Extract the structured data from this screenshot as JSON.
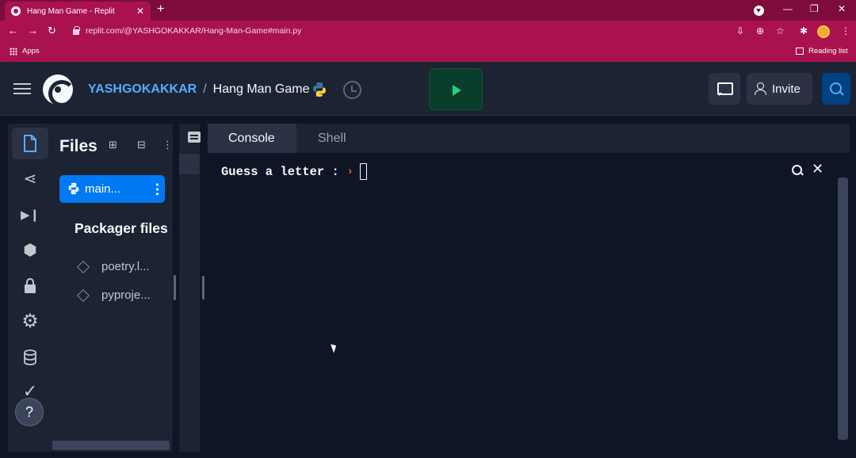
{
  "browser": {
    "tab_title": "Hang Man Game - Replit",
    "tab_close": "✕",
    "new_tab": "+",
    "url": "replit.com/@YASHGOKAKKAR/Hang-Man-Game#main.py",
    "apps_label": "Apps",
    "reading_list": "Reading list",
    "window_controls": {
      "minimize": "—",
      "restore": "❐",
      "close": "✕"
    },
    "nav": {
      "back": "←",
      "forward": "→",
      "reload": "↻"
    },
    "addr_icons": {
      "install": "⇩",
      "zoom": "⊕",
      "star": "☆",
      "extensions": "✱",
      "menu": "⋮"
    }
  },
  "header": {
    "user": "YASHGOKAKKAR",
    "separator": "/",
    "project": "Hang Man Game",
    "invite_label": "Invite"
  },
  "rail": {
    "icons": [
      "file-icon",
      "share-icon",
      "debugger-icon",
      "packages-icon",
      "secrets-icon",
      "settings-icon",
      "database-icon",
      "check-icon",
      "help-icon"
    ],
    "glyphs": {
      "share": "⋖",
      "debug": "▶❙",
      "packages": "⬢",
      "secrets": "🔒",
      "settings": "⚙",
      "database": "≋",
      "check": "✓",
      "help": "?"
    }
  },
  "files": {
    "title": "Files",
    "add_file_glyph": "⊞",
    "add_folder_glyph": "⊟",
    "menu_glyph": "⋮",
    "main_file": "main...",
    "packager_title": "Packager files",
    "packager_items": [
      "poetry.l...",
      "pyproje..."
    ]
  },
  "console": {
    "tabs": [
      "Console",
      "Shell"
    ],
    "prompt": "Guess a letter :",
    "caret": "›",
    "close_glyph": "✕"
  },
  "colors": {
    "brand_accent": "#0079f2",
    "run_green": "#26d07c",
    "chrome_magenta": "#a9124f",
    "background": "#0e1525",
    "panel": "#1c2333"
  }
}
